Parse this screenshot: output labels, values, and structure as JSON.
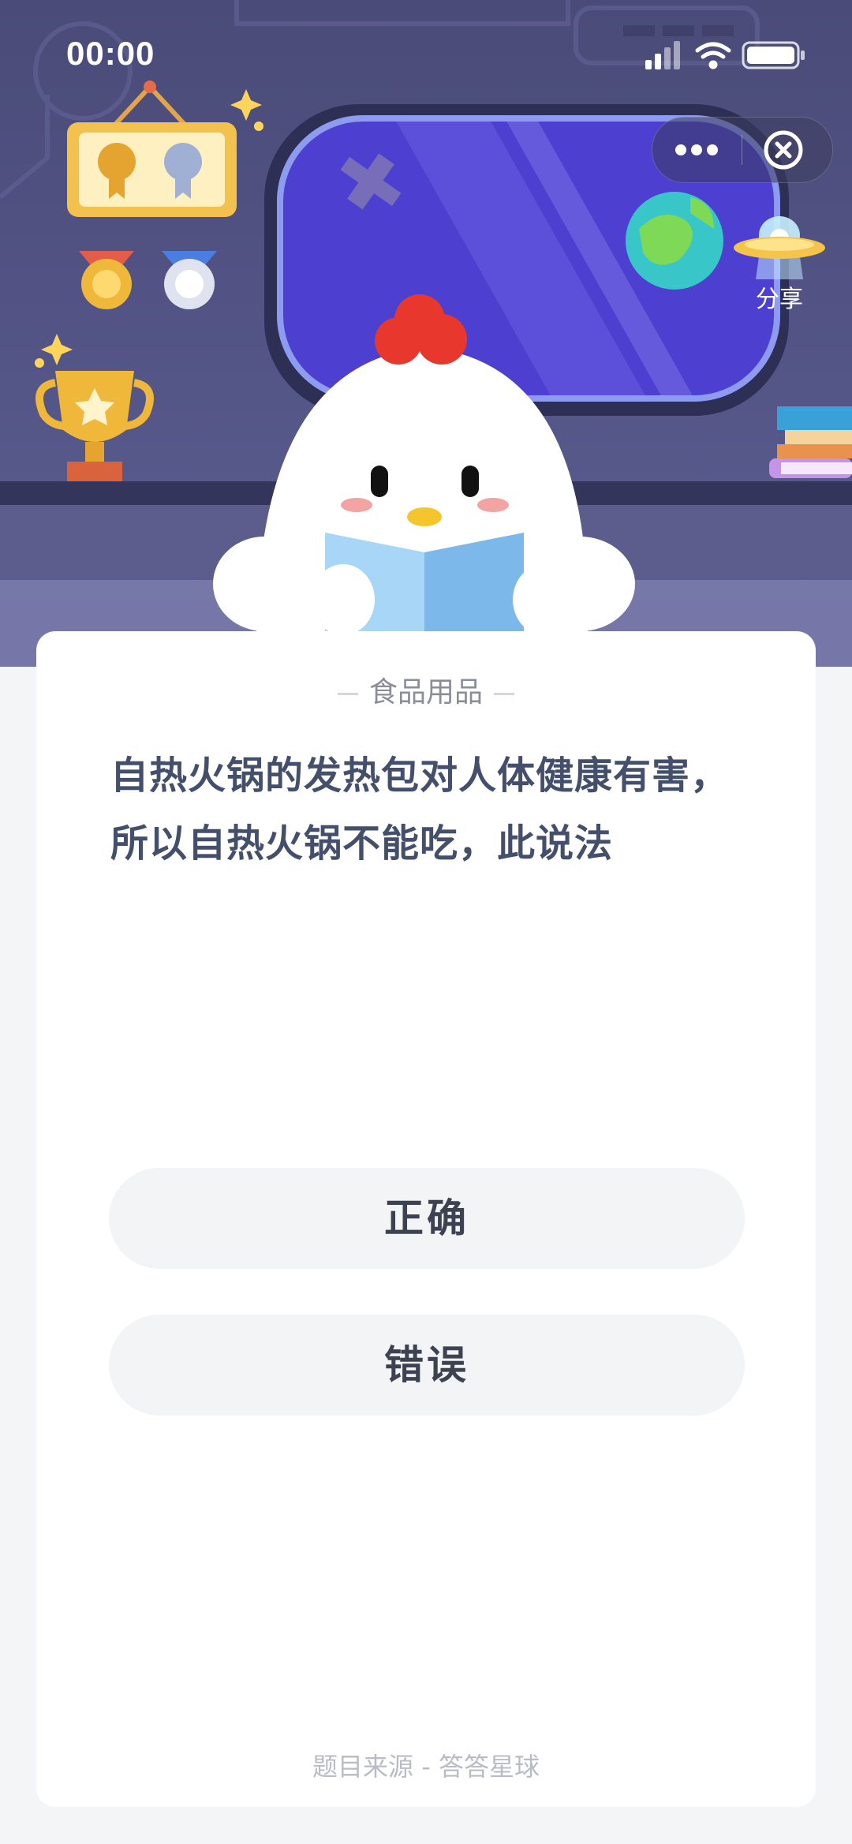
{
  "status_bar": {
    "time": "00:00"
  },
  "capsule": {
    "more_icon": "more-dots-icon",
    "close_icon": "close-circle-icon"
  },
  "share": {
    "label": "分享",
    "icon": "ufo-icon"
  },
  "question_card": {
    "category": "食品用品",
    "question": "自热火锅的发热包对人体健康有害，所以自热火锅不能吃，此说法",
    "options": [
      {
        "label": "正确"
      },
      {
        "label": "错误"
      }
    ],
    "source": "题目来源 - 答答星球"
  },
  "colors": {
    "hero_bg": "#4f5080",
    "page_bg": "#f4f5f6",
    "question_text": "#44506b",
    "option_bg": "#f3f4f6"
  }
}
